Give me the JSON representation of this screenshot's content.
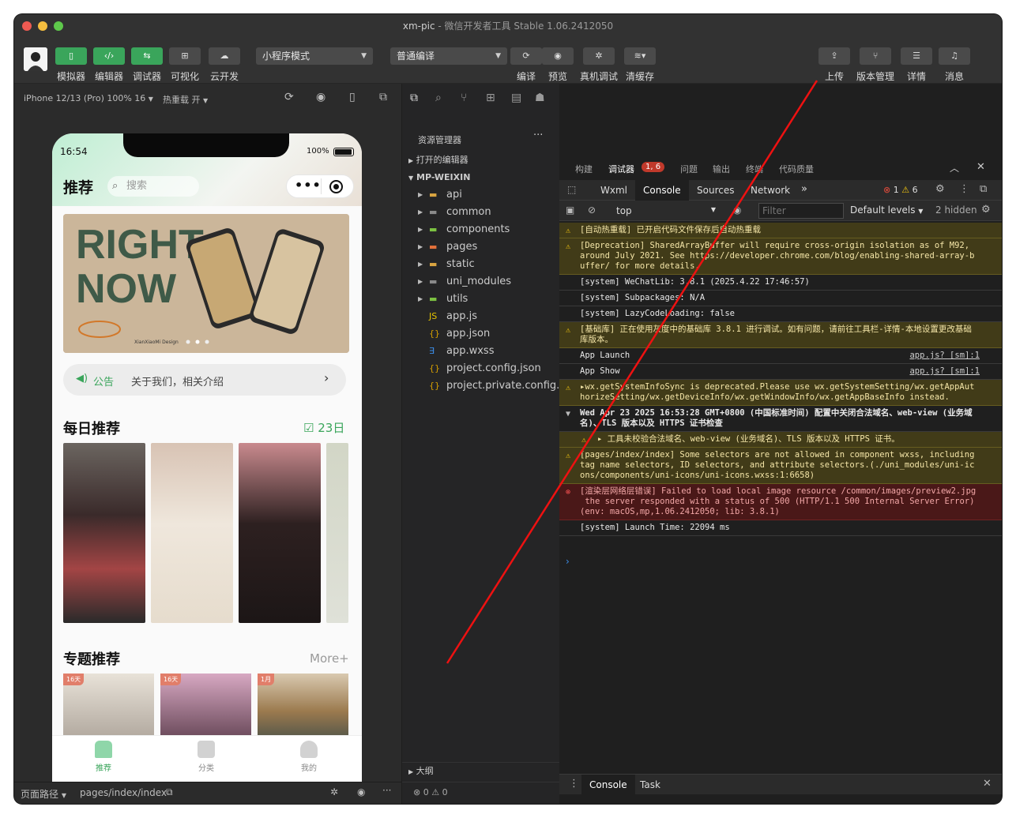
{
  "window": {
    "title_app": "xm-pic",
    "title_rest": " - 微信开发者工具 Stable 1.06.2412050"
  },
  "toolbar": {
    "simulator": "模拟器",
    "editor": "编辑器",
    "debugger": "调试器",
    "visual": "可视化",
    "cloud": "云开发",
    "mode": "小程序模式",
    "compile_mode": "普通编译",
    "compile": "编译",
    "preview": "预览",
    "remote_debug": "真机调试",
    "clear_cache": "清缓存",
    "upload": "上传",
    "version": "版本管理",
    "details": "详情",
    "messages": "消息"
  },
  "simbar": {
    "device": "iPhone 12/13 (Pro) 100% 16",
    "hotreload": "热重载 开"
  },
  "phone": {
    "time": "16:54",
    "battery": "100%",
    "nav_title": "推荐",
    "search_placeholder": "搜索",
    "banner_line1": "RIGHT",
    "banner_line2": "NOW",
    "banner_credit": "XianXiaoMi Design",
    "notice_label": "公告",
    "notice_text": "关于我们，相关介绍",
    "daily_title": "每日推荐",
    "daily_date": "23日",
    "topic_title": "专题推荐",
    "topic_more": "More+",
    "badges": [
      "16天",
      "16天",
      "1月"
    ],
    "tabs": [
      {
        "label": "推荐"
      },
      {
        "label": "分类"
      },
      {
        "label": "我的"
      }
    ]
  },
  "simbottom": {
    "path_label": "页面路径",
    "path": "pages/index/index"
  },
  "explorer": {
    "title": "资源管理器",
    "open_editors": "打开的编辑器",
    "project": "MP-WEIXIN",
    "items": [
      {
        "name": "api",
        "type": "folder",
        "color": "#d9a441"
      },
      {
        "name": "common",
        "type": "folder",
        "color": "#8a8a8a"
      },
      {
        "name": "components",
        "type": "folder",
        "color": "#7cc242"
      },
      {
        "name": "pages",
        "type": "folder",
        "color": "#e2703a"
      },
      {
        "name": "static",
        "type": "folder",
        "color": "#d9a441"
      },
      {
        "name": "uni_modules",
        "type": "folder",
        "color": "#8a8a8a"
      },
      {
        "name": "utils",
        "type": "folder",
        "color": "#7cc242"
      },
      {
        "name": "app.js",
        "type": "js",
        "color": "#e5c400"
      },
      {
        "name": "app.json",
        "type": "json",
        "color": "#d7a000"
      },
      {
        "name": "app.wxss",
        "type": "wxss",
        "color": "#3b8eea"
      },
      {
        "name": "project.config.json",
        "type": "json",
        "color": "#d7a000"
      },
      {
        "name": "project.private.config...",
        "type": "json",
        "color": "#d7a000"
      }
    ],
    "outline": "大纲",
    "status_errors": "0",
    "status_warnings": "0"
  },
  "devtools": {
    "panel_tabs": [
      "构建",
      "调试器",
      "问题",
      "输出",
      "终端",
      "代码质量"
    ],
    "debugger_badge": "1, 6",
    "tool_tabs": [
      "Wxml",
      "Console",
      "Sources",
      "Network"
    ],
    "error_count": "1",
    "warn_count": "6",
    "context": "top",
    "filter_placeholder": "Filter",
    "levels": "Default levels",
    "hidden": "2 hidden",
    "drawer_tabs": [
      "Console",
      "Task"
    ]
  },
  "console": [
    {
      "level": "warn",
      "text": "[自动热重载] 已开启代码文件保存后自动热重载"
    },
    {
      "level": "warn",
      "text": "[Deprecation] SharedArrayBuffer will require cross-origin isolation as of M92, around July 2021. See https://developer.chrome.com/blog/enabling-shared-array-buffer/ for more details."
    },
    {
      "level": "info",
      "text": "[system] WeChatLib: 3.8.1 (2025.4.22 17:46:57)"
    },
    {
      "level": "info",
      "text": "[system] Subpackages: N/A"
    },
    {
      "level": "info",
      "text": "[system] LazyCodeLoading: false"
    },
    {
      "level": "warn",
      "text": "[基础库] 正在使用灰度中的基础库 3.8.1 进行调试。如有问题，请前往工具栏-详情-本地设置更改基础库版本。"
    },
    {
      "level": "info",
      "text": "App Launch",
      "source": "app.js? [sm]:1"
    },
    {
      "level": "info",
      "text": "App Show",
      "source": "app.js? [sm]:1"
    },
    {
      "level": "warn",
      "text": "▸wx.getSystemInfoSync is deprecated.Please use wx.getSystemSetting/wx.getAppAuthorizeSetting/wx.getDeviceInfo/wx.getWindowInfo/wx.getAppBaseInfo instead."
    },
    {
      "level": "group",
      "text": "Wed Apr 23 2025 16:53:28 GMT+0800 (中国标准时间) 配置中关闭合法域名、web-view (业务域名)、TLS 版本以及 HTTPS 证书检查"
    },
    {
      "level": "warn-sub",
      "text": "▸ 工具未校验合法域名、web-view (业务域名)、TLS 版本以及 HTTPS 证书。"
    },
    {
      "level": "warn",
      "text": "[pages/index/index] Some selectors are not allowed in component wxss, including tag name selectors, ID selectors, and attribute selectors.(./uni_modules/uni-icons/components/uni-icons/uni-icons.wxss:1:6658)"
    },
    {
      "level": "error",
      "text": "[渲染层网络层错误] Failed to load local image resource /common/images/preview2.jpg\n the server responded with a status of 500 (HTTP/1.1 500 Internal Server Error)\n(env: macOS,mp,1.06.2412050; lib: 3.8.1)"
    },
    {
      "level": "info",
      "text": "[system] Launch Time: 22094 ms"
    }
  ]
}
